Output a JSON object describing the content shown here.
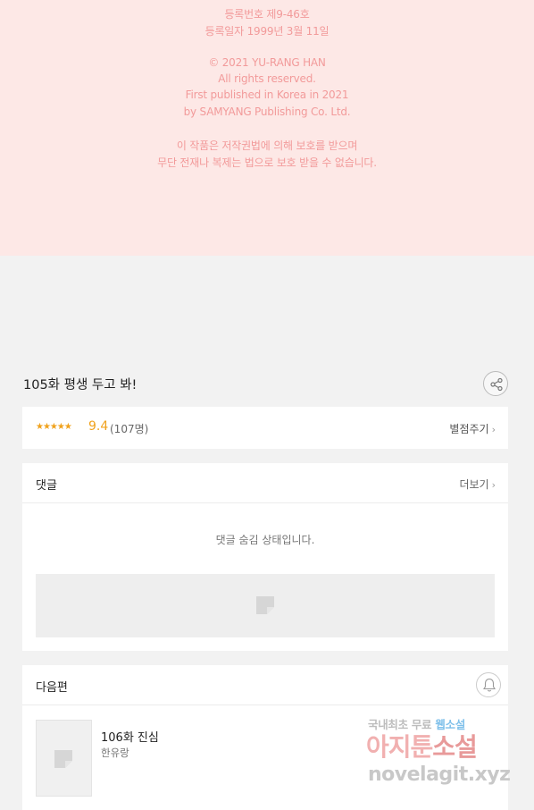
{
  "copyright": {
    "reg_number": "등록번호   제9-46호",
    "reg_date": "등록일자   1999년 3월 11일",
    "copyright_line": "© 2021 YU-RANG HAN",
    "rights": "All rights reserved.",
    "first_published": "First published in Korea in 2021",
    "publisher": "by SAMYANG Publishing Co. Ltd.",
    "notice_1": "이 작품은 저작권법에 의해 보호를 받으며",
    "notice_2": "무단 전재나 복제는 법으로 보호 받을 수 없습니다."
  },
  "episode": {
    "title": "105화 평생 두고 봐!"
  },
  "rating": {
    "stars": "★★★★★",
    "score": "9.4",
    "votes": "(107명)",
    "rate_label": "별점주기",
    "accent": "#f0a21d"
  },
  "comments": {
    "header": "댓글",
    "more_label": "더보기",
    "hidden_message": "댓글 숨김 상태입니다."
  },
  "next_episode": {
    "header": "다음편",
    "title": "106화 진심",
    "author": "한유랑"
  },
  "watermark": {
    "line1": "국내최초 무료 ",
    "line1_highlight": "웹소설",
    "line2": "아지툰",
    "line2_highlight": "소설",
    "line3": "novelagit.xyz"
  },
  "icons": {
    "share": "share-icon",
    "bell": "bell-icon",
    "chevron": "chevron-right-icon",
    "placeholder": "image-placeholder-icon"
  }
}
